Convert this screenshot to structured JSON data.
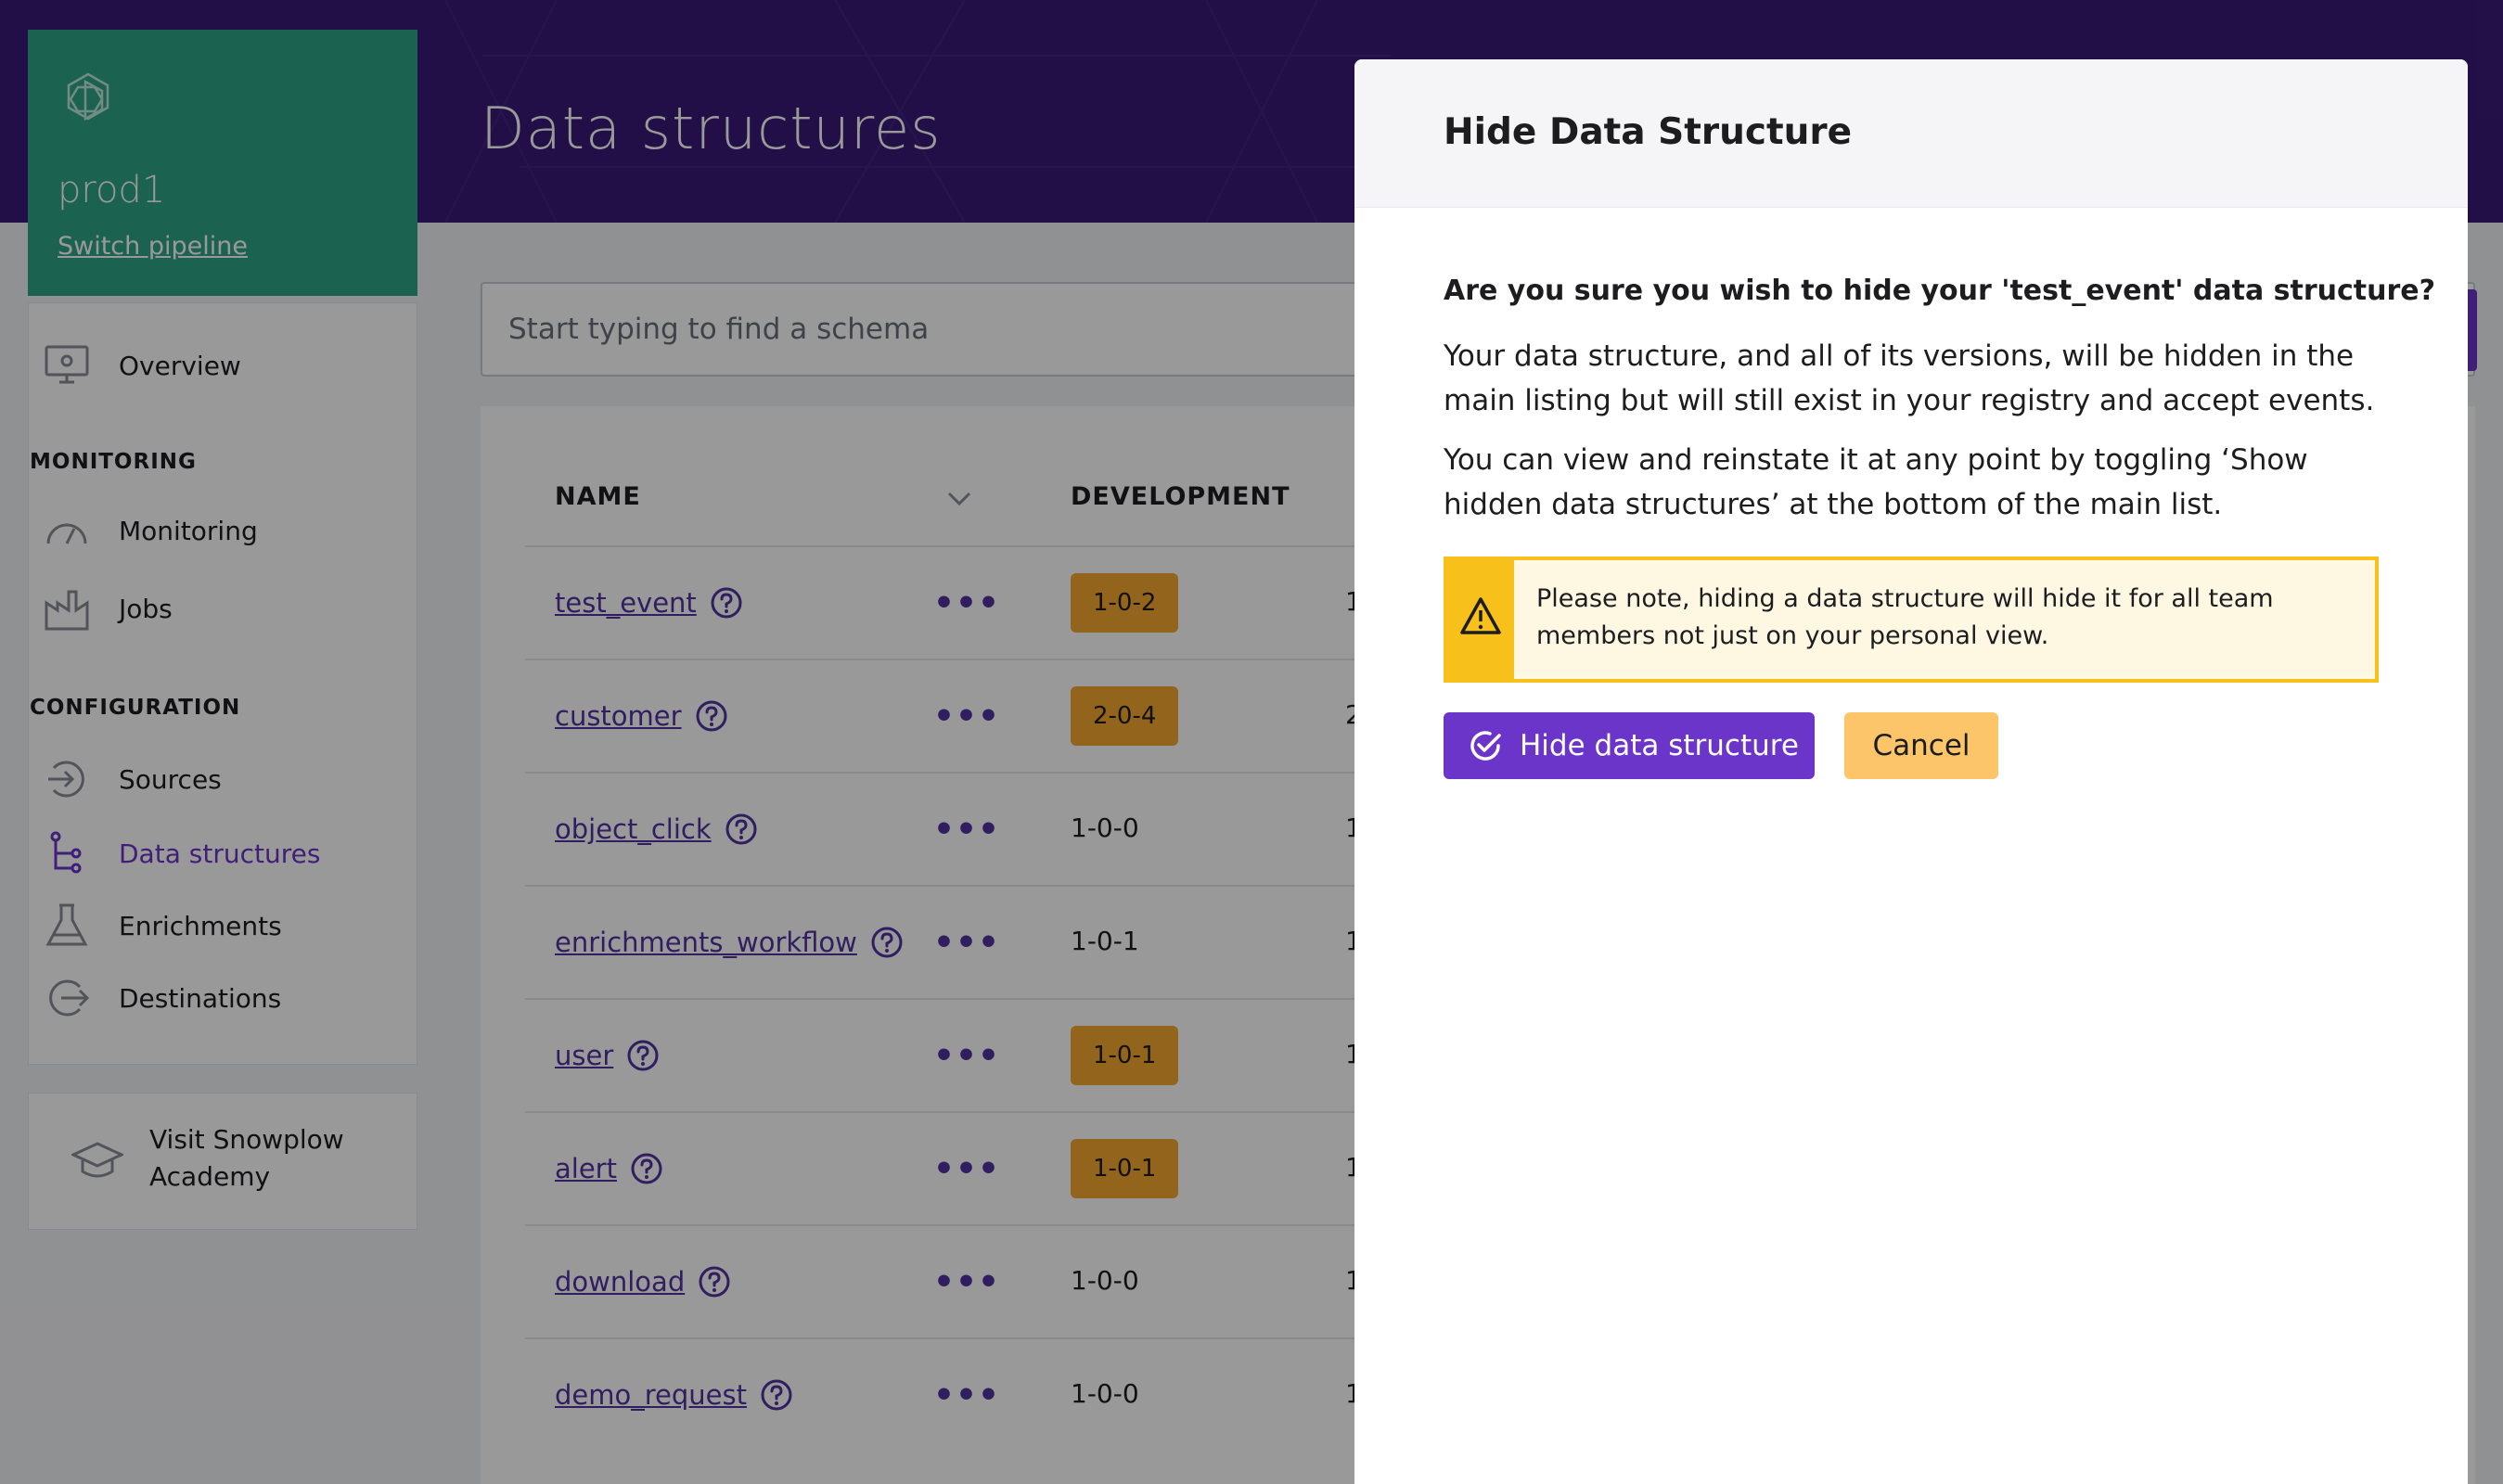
{
  "header": {
    "title": "Data structures"
  },
  "sidebar": {
    "pipeline_name": "prod1",
    "switch_label": "Switch pipeline",
    "overview_label": "Overview",
    "monitoring_section": "MONITORING",
    "monitoring_label": "Monitoring",
    "jobs_label": "Jobs",
    "configuration_section": "CONFIGURATION",
    "sources_label": "Sources",
    "data_structures_label": "Data structures",
    "enrichments_label": "Enrichments",
    "destinations_label": "Destinations",
    "academy_line1": "Visit Snowplow",
    "academy_line2": "Academy"
  },
  "search": {
    "placeholder": "Start typing to find a schema"
  },
  "table": {
    "columns": [
      "NAME",
      "DEVELOPMENT"
    ],
    "rows": [
      {
        "name": "test_event",
        "development": "1-0-2",
        "highlight": true,
        "prod": "1"
      },
      {
        "name": "customer",
        "development": "2-0-4",
        "highlight": true,
        "prod": "2"
      },
      {
        "name": "object_click",
        "development": "1-0-0",
        "highlight": false,
        "prod": "1"
      },
      {
        "name": "enrichments_workflow",
        "development": "1-0-1",
        "highlight": false,
        "prod": "1"
      },
      {
        "name": "user",
        "development": "1-0-1",
        "highlight": true,
        "prod": "1"
      },
      {
        "name": "alert",
        "development": "1-0-1",
        "highlight": true,
        "prod": "1"
      },
      {
        "name": "download",
        "development": "1-0-0",
        "highlight": false,
        "prod": "1"
      },
      {
        "name": "demo_request",
        "development": "1-0-0",
        "highlight": false,
        "prod": "1"
      }
    ],
    "actions_glyph": "•••"
  },
  "modal": {
    "title": "Hide Data Structure",
    "question": "Are you sure you wish to hide your 'test_event' data structure?",
    "para1": "Your data structure, and all of its versions, will be hidden in the main listing but will still exist in your registry and accept events.",
    "para2": "You can view and reinstate it at any point by toggling ‘Show hidden data structures’ at the bottom of the main list.",
    "note": "Please note, hiding a data structure will hide it for all team members not just on your personal view.",
    "hide_button": "Hide data structure",
    "cancel_button": "Cancel"
  },
  "colors": {
    "brand_purple": "#6c35c9",
    "header_purple": "#3b1a78",
    "pipeline_green": "#2fa386",
    "badge_orange": "#f3a72f",
    "warning_yellow": "#f8c01b",
    "cancel_yellow": "#fcc56a"
  },
  "icons": {
    "logo": "hexagon-logo-icon",
    "overview": "monitor-icon",
    "monitoring": "gauge-icon",
    "jobs": "factory-icon",
    "sources": "sign-in-icon",
    "data_structures": "tree-icon",
    "enrichments": "flask-icon",
    "destinations": "sign-out-icon",
    "academy": "graduation-cap-icon",
    "help": "question-circle-icon",
    "sort": "chevron-down-icon",
    "warning": "warning-triangle-icon",
    "confirm": "check-circle-icon"
  }
}
